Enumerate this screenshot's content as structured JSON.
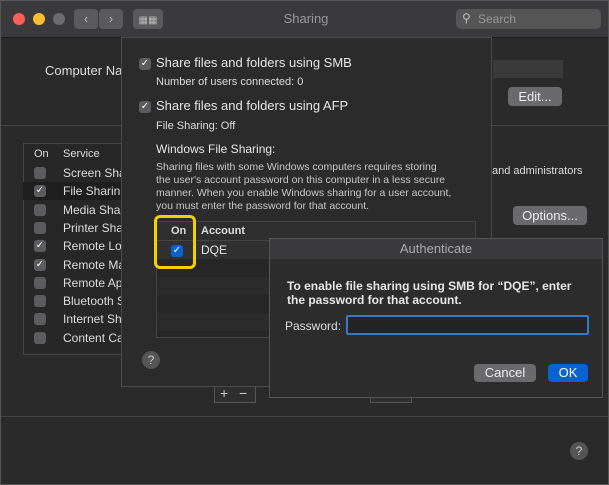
{
  "window": {
    "title": "Sharing"
  },
  "search": {
    "placeholder": "Search"
  },
  "main": {
    "computer_name_label": "Computer Na",
    "edit_button": "Edit...",
    "options_button": "Options...",
    "side_text": "and administrators",
    "service_header": {
      "on": "On",
      "service": "Service"
    },
    "services": [
      {
        "label": "Screen Sha",
        "checked": false,
        "selected": false
      },
      {
        "label": "File Sharin",
        "checked": true,
        "selected": true
      },
      {
        "label": "Media Shar",
        "checked": false,
        "selected": false
      },
      {
        "label": "Printer Sha",
        "checked": false,
        "selected": false
      },
      {
        "label": "Remote Lo",
        "checked": true,
        "selected": false
      },
      {
        "label": "Remote Ma",
        "checked": true,
        "selected": false
      },
      {
        "label": "Remote Ap",
        "checked": false,
        "selected": false
      },
      {
        "label": "Bluetooth S",
        "checked": false,
        "selected": false
      },
      {
        "label": "Internet Sh",
        "checked": false,
        "selected": false
      },
      {
        "label": "Content Ca",
        "checked": false,
        "selected": false
      }
    ],
    "plus": "+",
    "minus": "−"
  },
  "sheet": {
    "smb_label": "Share files and folders using SMB",
    "smb_sub": "Number of users connected: 0",
    "afp_label": "Share files and folders using AFP",
    "afp_sub": "File Sharing: Off",
    "windows_heading": "Windows File Sharing:",
    "windows_desc": [
      "Sharing files with some Windows computers requires storing",
      "the user's account password on this computer in a less secure",
      "manner. When you enable Windows sharing for a user account,",
      "you must enter the password for that account."
    ],
    "table_header": {
      "on": "On",
      "account": "Account"
    },
    "account": "DQE",
    "help": "?"
  },
  "auth": {
    "title": "Authenticate",
    "message_line1": "To enable file sharing using SMB for “DQE”, enter",
    "message_line2": "the password for that account.",
    "password_label": "Password:",
    "password_value": "",
    "cancel": "Cancel",
    "ok": "OK"
  },
  "window_help": "?",
  "colors": {
    "accent": "#0a62d0",
    "highlight": "#f4d000",
    "close": "#fe5f57",
    "minimize": "#febc2e",
    "zoom": "#5d5d5f"
  }
}
